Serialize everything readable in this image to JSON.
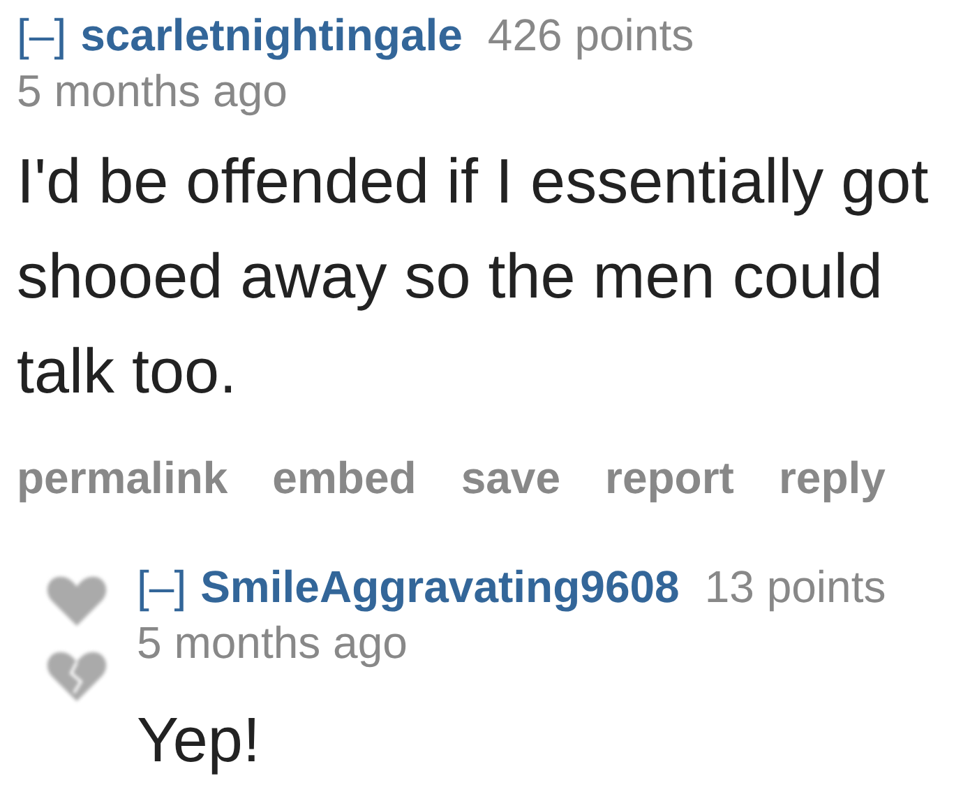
{
  "comment": {
    "toggle": "[–]",
    "author": "scarletnightingale",
    "score": "426 points",
    "time": "5 months ago",
    "body": "I'd be offended if I essentially got shooed away so the men could talk too.",
    "actions": [
      "permalink",
      "embed",
      "save",
      "report",
      "reply"
    ],
    "replies": [
      {
        "toggle": "[–]",
        "author": "SmileAggravating9608",
        "score": "13 points",
        "time": "5 months ago",
        "body": "Yep!"
      }
    ]
  }
}
